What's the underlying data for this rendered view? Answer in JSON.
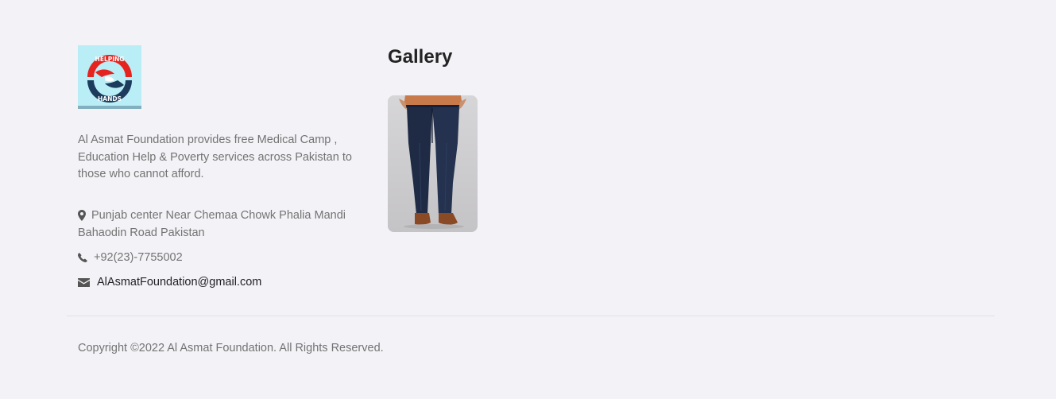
{
  "brand": {
    "logo_icon": "helping-hands-logo",
    "logo_text_top": "HELPING",
    "logo_text_bottom": "HANDS"
  },
  "about": {
    "description": "Al Asmat Foundation provides free Medical Camp , Education Help & Poverty services across Pakistan to those who cannot afford."
  },
  "contact": {
    "address_icon": "map-marker-icon",
    "address": "Punjab center Near Chemaa Chowk Phalia Mandi Bahaodin Road Pakistan",
    "phone_icon": "phone-icon",
    "phone": "+92(23)-7755002",
    "email_icon": "envelope-icon",
    "email": "AlAsmatFoundation@gmail.com"
  },
  "gallery": {
    "title": "Gallery",
    "images": [
      "jeans-photo"
    ]
  },
  "footer": {
    "copyright": "Copyright ©2022 Al Asmat Foundation. All Rights Reserved."
  },
  "colors": {
    "background": "#f3f2f7",
    "text_muted": "#737373",
    "text_dark": "#232323",
    "logo_red": "#e5231f",
    "logo_navy": "#1d3b5c",
    "logo_bg": "#b9eef6"
  }
}
